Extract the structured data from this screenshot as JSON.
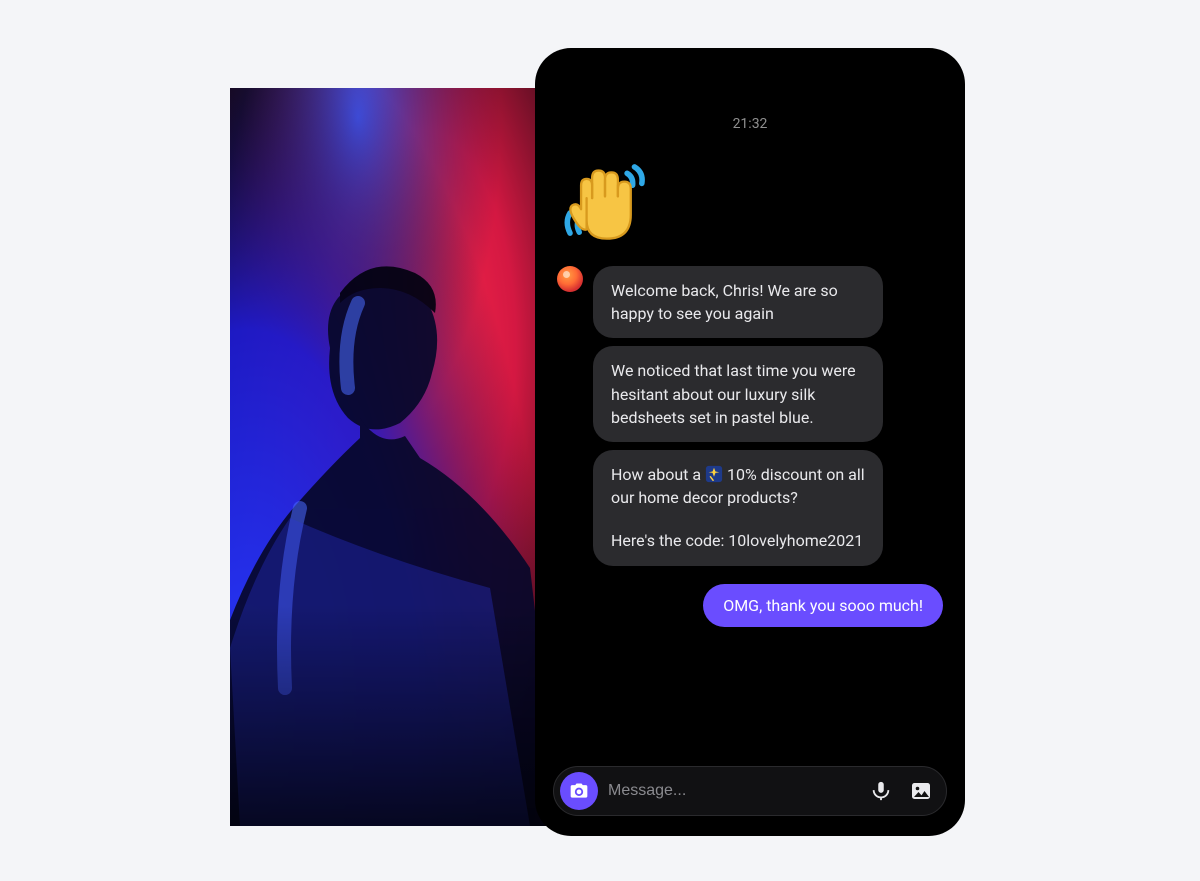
{
  "chat": {
    "timestamp": "21:32",
    "agent_messages": [
      "Welcome back, Chris! We are so happy to see you again",
      "We noticed that last time you were hesitant about our luxury silk bedsheets set in pastel blue.",
      "How about a 💫 10% discount on all our home decor products?",
      "Here's the code: 10lovelyhome2021"
    ],
    "user_message": "OMG, thank you sooo much!",
    "input_placeholder": "Message...",
    "wave_emoji": "👋",
    "sparkle_emoji": "💫"
  },
  "colors": {
    "accent": "#6a4dff",
    "bubble_bg": "#2b2b2e",
    "page_bg": "#f4f5f8"
  }
}
